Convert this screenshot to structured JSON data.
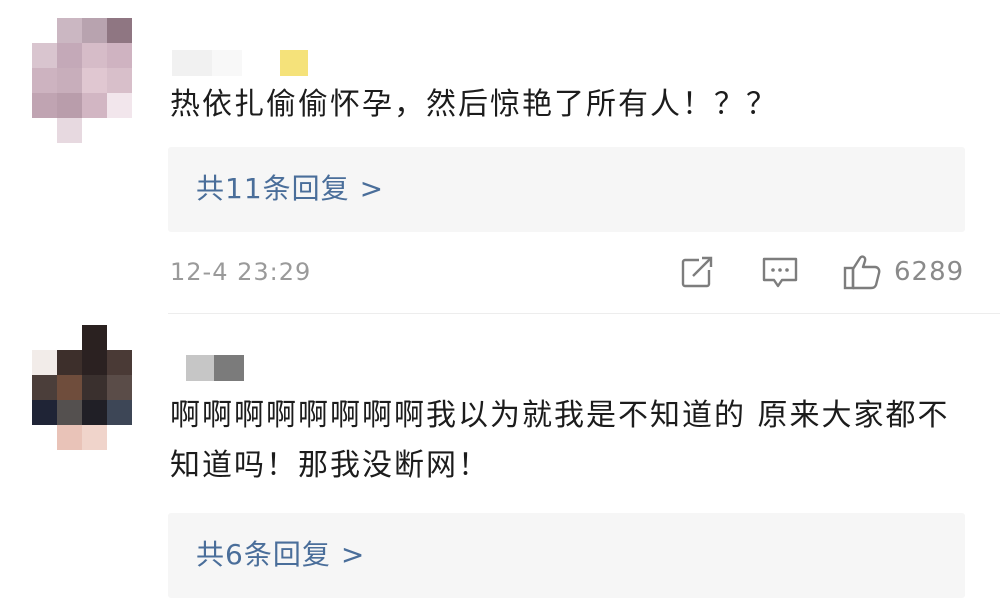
{
  "comments": [
    {
      "text": "热依扎偷偷怀孕，然后惊艳了所有人！？？",
      "reply_label": "共11条回复",
      "reply_chevron": ">",
      "timestamp": "12-4 23:29",
      "like_count": "6289",
      "avatar_icon": "pixelated-avatar",
      "username_icon": "pixelated-username"
    },
    {
      "text": "啊啊啊啊啊啊啊啊我以为就我是不知道的 原来大家都不知道吗！那我没断网！",
      "reply_label": "共6条回复",
      "reply_chevron": ">",
      "avatar_icon": "pixelated-avatar",
      "username_icon": "pixelated-username"
    }
  ],
  "icons": {
    "share": "share-icon",
    "comment": "comment-icon",
    "like": "thumbs-up-icon"
  },
  "colors": {
    "link": "#4a6e9a",
    "meta": "#9a9a9a",
    "reply_bg": "#f6f6f6",
    "text": "#1c1c1c"
  }
}
